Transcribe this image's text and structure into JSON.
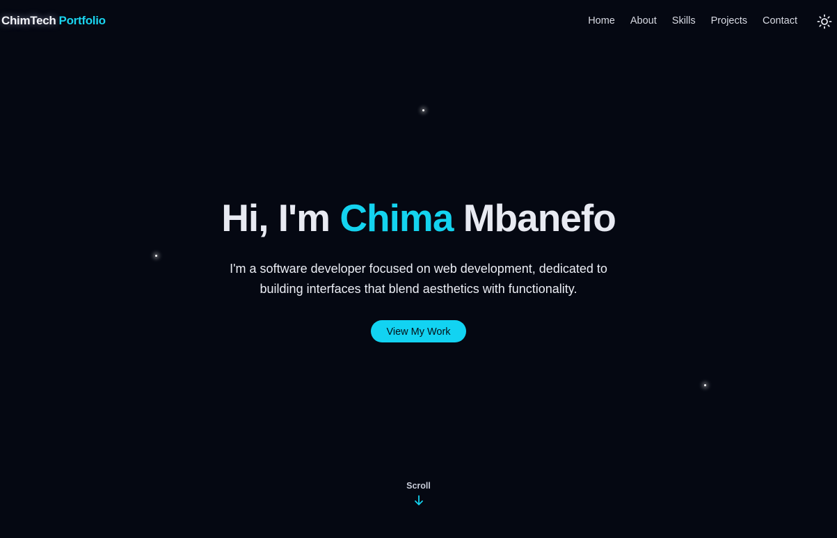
{
  "header": {
    "logo_main": "ChimTech",
    "logo_accent": "Portfolio",
    "nav": [
      {
        "label": "Home"
      },
      {
        "label": "About"
      },
      {
        "label": "Skills"
      },
      {
        "label": "Projects"
      },
      {
        "label": "Contact"
      }
    ],
    "theme_toggle_icon": "sun-icon"
  },
  "hero": {
    "greeting": "Hi, I'm",
    "first_name": "Chima",
    "last_name": "Mbanefo",
    "description": "I'm a software developer focused on web development, dedicated to building interfaces that blend aesthetics with functionality.",
    "cta_label": "View My Work"
  },
  "scroll": {
    "label": "Scroll",
    "icon": "arrow-down-icon"
  },
  "colors": {
    "background": "#050812",
    "accent": "#14d3ef",
    "text": "#e8eaf2"
  }
}
